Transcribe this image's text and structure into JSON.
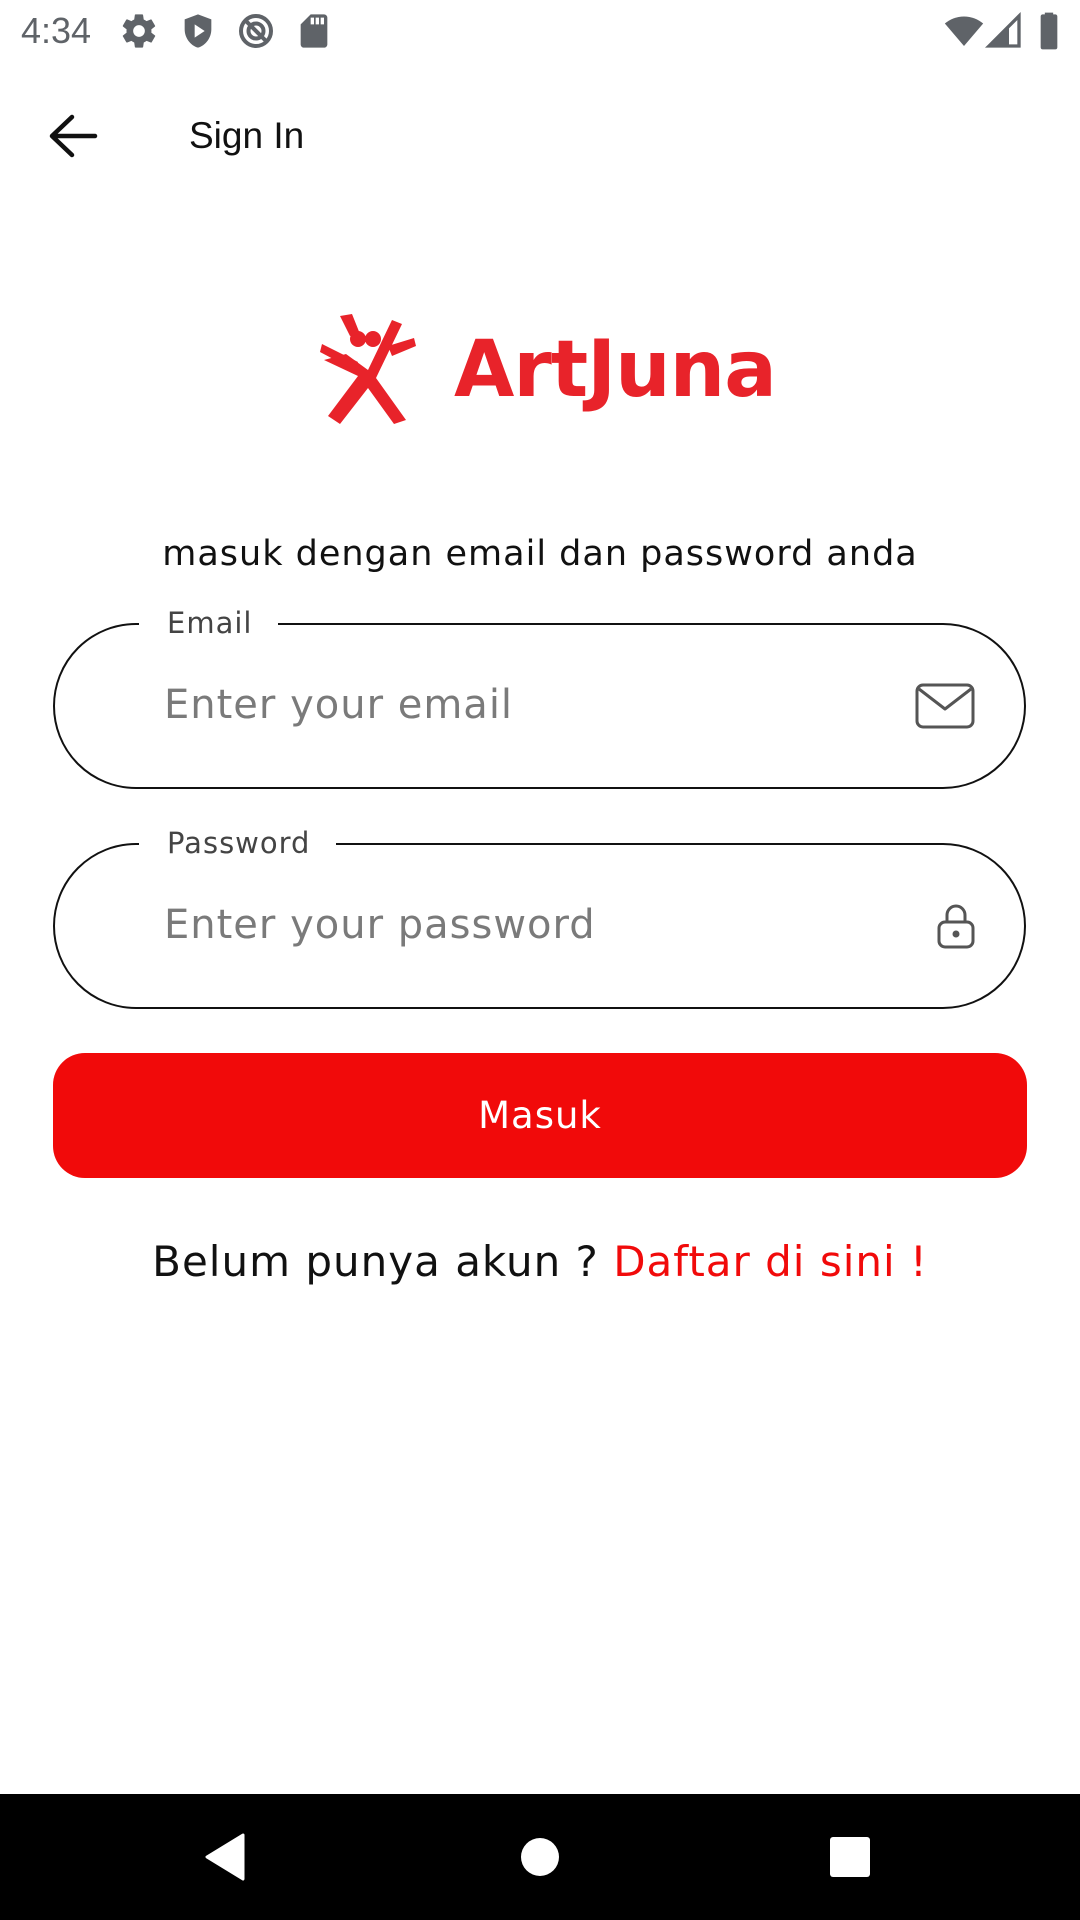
{
  "status_bar": {
    "time": "4:34",
    "left_icons": [
      "gear-icon",
      "shield-icon",
      "no-sync-icon",
      "sd-card-icon"
    ],
    "right_icons": [
      "wifi-icon",
      "cell-signal-icon",
      "battery-icon"
    ]
  },
  "app_bar": {
    "back_icon": "arrow-left-icon",
    "title": "Sign In"
  },
  "logo": {
    "text": "ArtJuna",
    "color": "#e8232a"
  },
  "form": {
    "subtitle": "masuk dengan email dan password anda",
    "email": {
      "label": "Email",
      "placeholder": "Enter your email",
      "value": "",
      "icon": "mail-icon"
    },
    "password": {
      "label": "Password",
      "placeholder": "Enter your password",
      "value": "",
      "icon": "lock-icon"
    },
    "submit_label": "Masuk",
    "submit_color": "#f10a0a"
  },
  "signup": {
    "prompt": "Belum punya akun ? ",
    "link": "Daftar di sini !"
  },
  "nav_bar": {
    "icons": [
      "back-triangle-icon",
      "home-circle-icon",
      "recents-square-icon"
    ]
  }
}
